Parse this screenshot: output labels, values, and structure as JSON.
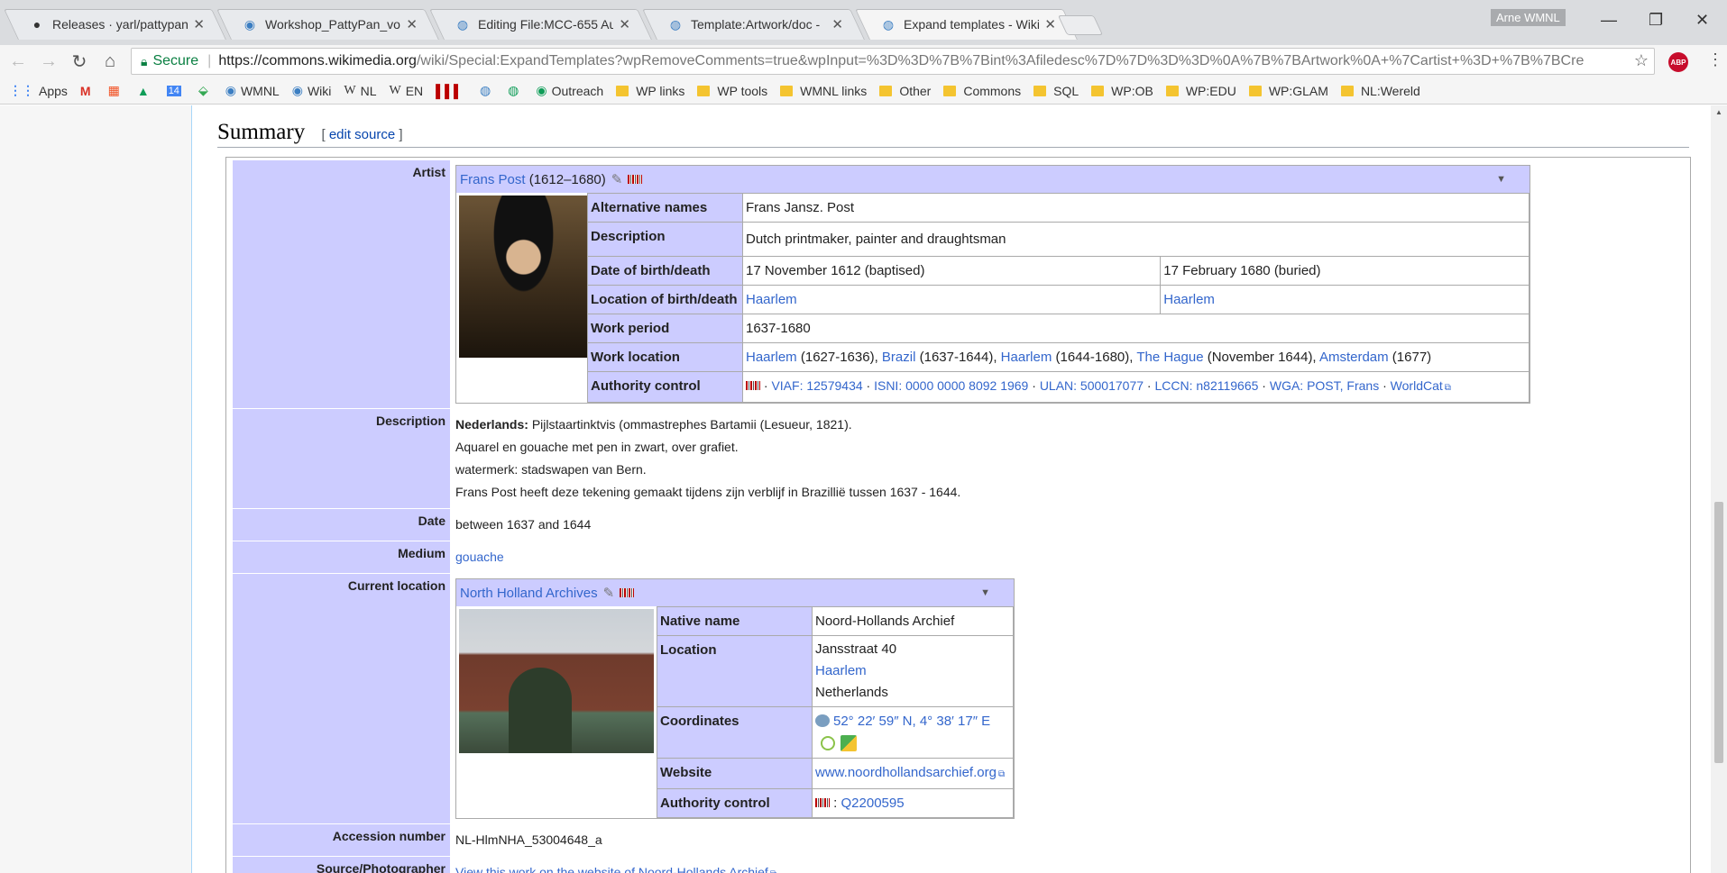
{
  "browser": {
    "tabs": [
      {
        "title": "Releases · yarl/pattypan",
        "icon": "github-icon"
      },
      {
        "title": "Workshop_PattyPan_voo",
        "icon": "wikimedia-icon"
      },
      {
        "title": "Editing File:MCC-655 Au",
        "icon": "commons-icon"
      },
      {
        "title": "Template:Artwork/doc - ",
        "icon": "commons-icon"
      },
      {
        "title": "Expand templates - Wikim",
        "icon": "commons-icon"
      }
    ],
    "close_glyph": "✕",
    "profile": "Arne WMNL",
    "secure_label": "Secure",
    "url_host": "https://commons.wikimedia.org",
    "url_rest": "/wiki/Special:ExpandTemplates?wpRemoveComments=true&wpInput=%3D%3D%7B%7Bint%3Afiledesc%7D%7D%3D%3D%0A%7B%7BArtwork%0A+%7Cartist+%3D+%7B%7BCre",
    "abp": "ABP",
    "bookmarks": [
      {
        "label": "Apps",
        "type": "apps"
      },
      {
        "label": "",
        "type": "gmail"
      },
      {
        "label": "",
        "type": "office"
      },
      {
        "label": "",
        "type": "drive"
      },
      {
        "label": "14",
        "type": "calendar"
      },
      {
        "label": "",
        "type": "maps"
      },
      {
        "label": "WMNL",
        "type": "wiki"
      },
      {
        "label": "Wiki",
        "type": "wiki"
      },
      {
        "label": "NL",
        "type": "w"
      },
      {
        "label": "EN",
        "type": "w"
      },
      {
        "label": "",
        "type": "barcode"
      },
      {
        "label": "",
        "type": "commons"
      },
      {
        "label": "",
        "type": "commons"
      },
      {
        "label": "Outreach",
        "type": "wiki"
      },
      {
        "label": "WP links",
        "type": "folder"
      },
      {
        "label": "WP tools",
        "type": "folder"
      },
      {
        "label": "WMNL links",
        "type": "folder"
      },
      {
        "label": "Other",
        "type": "folder"
      },
      {
        "label": "Commons",
        "type": "folder"
      },
      {
        "label": "SQL",
        "type": "folder"
      },
      {
        "label": "WP:OB",
        "type": "folder"
      },
      {
        "label": "WP:EDU",
        "type": "folder"
      },
      {
        "label": "WP:GLAM",
        "type": "folder"
      },
      {
        "label": "NL:Wereld",
        "type": "folder"
      }
    ]
  },
  "page": {
    "heading": "Summary",
    "edit_open": "[",
    "edit_link": "edit source",
    "edit_close": "]",
    "artist": {
      "label": "Artist",
      "name": "Frans Post",
      "dates": "(1612–1680)",
      "rows": {
        "alt_names_k": "Alternative names",
        "alt_names_v": "Frans Jansz. Post",
        "desc_k": "Description",
        "desc_v": "Dutch printmaker, painter and draughtsman",
        "dob_k": "Date of birth/death",
        "dob_v": "17 November 1612 (baptised)",
        "dod_v": "17 February 1680 (buried)",
        "loc_k": "Location of birth/death",
        "loc_birth": "Haarlem",
        "loc_death": "Haarlem",
        "period_k": "Work period",
        "period_v": "1637-1680",
        "wloc_k": "Work location",
        "wloc": [
          {
            "link": "Haarlem",
            "text": " (1627-1636), "
          },
          {
            "link": "Brazil",
            "text": " (1637-1644), "
          },
          {
            "link": "Haarlem",
            "text": " (1644-1680), "
          },
          {
            "link": "The Hague",
            "text": " (November 1644), "
          },
          {
            "link": "Amsterdam",
            "text": " (1677)"
          }
        ],
        "auth_k": "Authority control",
        "auth": [
          "VIAF: 12579434",
          "ISNI: 0000 0000 8092 1969",
          "ULAN: 500017077",
          "LCCN: n82119665",
          "WGA: POST, Frans",
          "WorldCat"
        ]
      }
    },
    "description": {
      "label": "Description",
      "lang": "Nederlands:",
      "line1": "Pijlstaartinktvis (ommastrephes Bartamii (Lesueur, 1821).",
      "line2": "Aquarel en gouache met pen in zwart, over grafiet.",
      "line3": "watermerk: stadswapen van Bern.",
      "line4": "Frans Post heeft deze tekening gemaakt tijdens zijn verblijf in Brazillië tussen 1637 - 1644."
    },
    "date": {
      "label": "Date",
      "value": "between 1637 and 1644"
    },
    "medium": {
      "label": "Medium",
      "value": "gouache"
    },
    "location": {
      "label": "Current location",
      "name": "North Holland Archives",
      "native_k": "Native name",
      "native_v": "Noord-Hollands Archief",
      "loc_k": "Location",
      "street": "Jansstraat 40",
      "city": "Haarlem",
      "country": "Netherlands",
      "coord_k": "Coordinates",
      "coord_v": "52° 22′ 59″ N, 4° 38′ 17″ E",
      "web_k": "Website",
      "web_v": "www.noordhollandsarchief.org",
      "auth_k": "Authority control",
      "auth_v": "Q2200595"
    },
    "accession": {
      "label": "Accession number",
      "value": "NL-HlmNHA_53004648_a"
    },
    "source": {
      "label": "Source/Photographer",
      "value": "View this work on the website of Noord-Hollands Archief"
    }
  }
}
